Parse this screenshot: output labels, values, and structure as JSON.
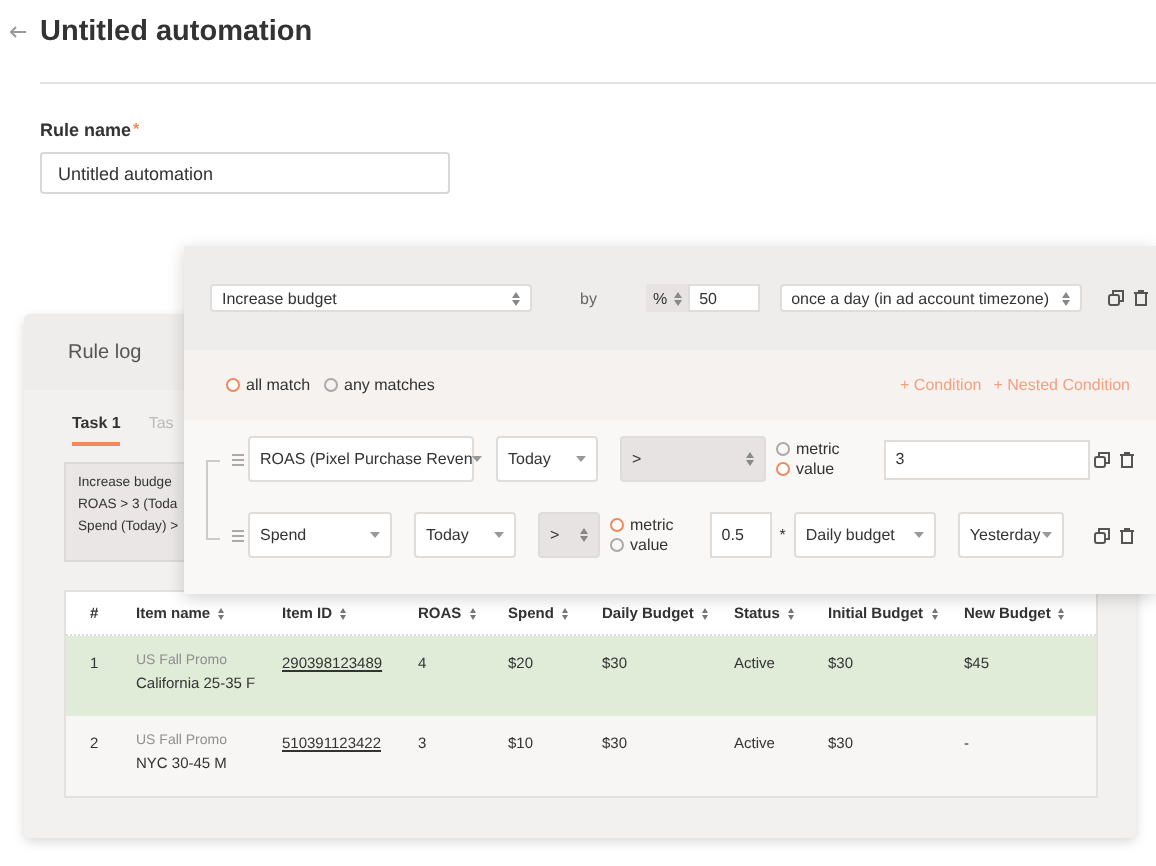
{
  "header": {
    "title": "Untitled automation"
  },
  "rule_name": {
    "label": "Rule name",
    "required_mark": "*",
    "value": "Untitled automation"
  },
  "rule_log": {
    "title": "Rule log",
    "tabs": [
      {
        "label": "Task 1",
        "selected": true
      },
      {
        "label": "Tas",
        "selected": false
      }
    ],
    "summary": [
      "Increase budge",
      "ROAS > 3 (Toda",
      "Spend (Today) >"
    ],
    "table": {
      "columns": [
        "#",
        "Item name",
        "Item ID",
        "ROAS",
        "Spend",
        "Daily Budget",
        "Status",
        "Initial Budget",
        "New Budget"
      ],
      "rows": [
        {
          "number": "1",
          "campaign": "US Fall Promo",
          "name": "California 25-35 F",
          "item_id": "290398123489",
          "roas": "4",
          "spend": "$20",
          "daily_budget": "$30",
          "status": "Active",
          "initial_budget": "$30",
          "new_budget": "$45",
          "highlighted": true
        },
        {
          "number": "2",
          "campaign": "US Fall Promo",
          "name": "NYC 30-45 M",
          "item_id": "510391123422",
          "roas": "3",
          "spend": "$10",
          "daily_budget": "$30",
          "status": "Active",
          "initial_budget": "$30",
          "new_budget": "-",
          "highlighted": false
        }
      ]
    }
  },
  "rule_editor": {
    "action": "Increase budget",
    "by": "by",
    "unit": "%",
    "amount": "50",
    "frequency": "once a day (in ad account timezone)",
    "match": [
      {
        "label": "all match",
        "selected": true
      },
      {
        "label": "any matches",
        "selected": false
      }
    ],
    "links": [
      "+ Condition",
      "+ Nested Condition"
    ],
    "conditions": [
      {
        "kind": "value",
        "metric": "ROAS (Pixel Purchase Reven",
        "period": "Today",
        "operator": ">",
        "compare": [
          {
            "label": "metric",
            "selected": false
          },
          {
            "label": "value",
            "selected": true
          }
        ],
        "value": "3"
      },
      {
        "kind": "metric",
        "metric": "Spend",
        "period": "Today",
        "operator": ">",
        "compare": [
          {
            "label": "metric",
            "selected": true
          },
          {
            "label": "value",
            "selected": false
          }
        ],
        "factor": "0.5",
        "times": "*",
        "target_metric": "Daily budget",
        "target_period": "Yesterday"
      }
    ]
  }
}
